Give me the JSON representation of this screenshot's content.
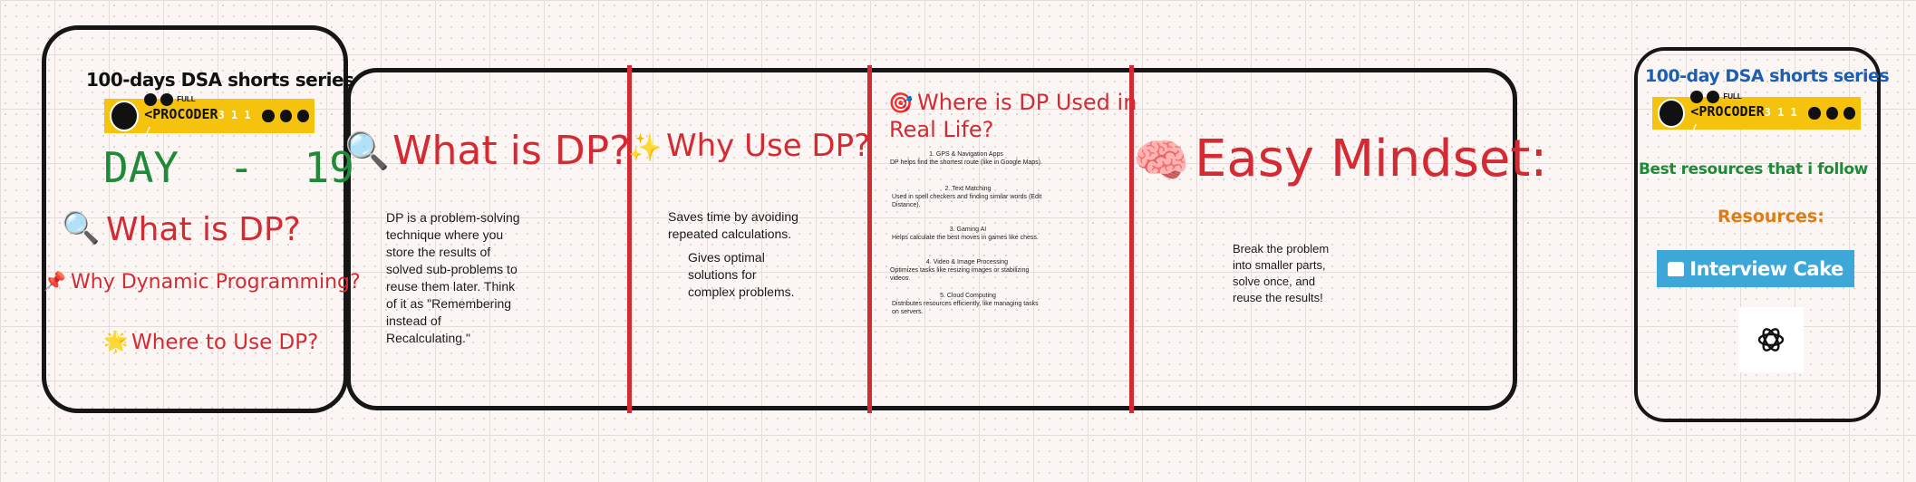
{
  "left_card": {
    "series_title": "100-days DSA shorts series",
    "banner_name": "<PROCODER",
    "banner_suffix": "3 1 1 /",
    "day_label": "DAY  -  19",
    "what_is_dp": "What is DP?",
    "why_dp": "Why Dynamic Programming?",
    "where_dp": "Where to Use DP?",
    "icons": [
      "magnifier-icon",
      "pushpin-icon",
      "sparkle-icon"
    ]
  },
  "what_is_dp": {
    "heading": "What is DP?",
    "body": [
      "DP is a problem-solving",
      "technique where you",
      "store the results of",
      "solved sub-problems to",
      "reuse them later. Think",
      "of it as \"Remembering",
      "instead of",
      "Recalculating.\""
    ]
  },
  "why_use_dp": {
    "heading": "Why Use DP?",
    "line1": [
      "Saves time by avoiding",
      "repeated calculations."
    ],
    "line2": [
      "Gives optimal",
      "solutions for",
      "complex problems."
    ]
  },
  "real_life": {
    "heading_line1": "Where is DP Used in",
    "heading_line2": "Real Life?",
    "items": [
      {
        "title": "1. GPS & Navigation Apps",
        "desc": "DP helps find the shortest route (like in Google Maps)."
      },
      {
        "title": "2. Text Matching",
        "desc": "Used in spell checkers and finding similar words (Edit Distance)."
      },
      {
        "title": "3. Gaming AI",
        "desc": "Helps calculate the best moves in games like chess."
      },
      {
        "title": "4. Video & Image Processing",
        "desc": "Optimizes tasks like resizing images or stabilizing videos."
      },
      {
        "title": "5. Cloud Computing",
        "desc": "Distributes resources efficiently, like managing tasks on servers."
      }
    ]
  },
  "mindset": {
    "heading": "Easy Mindset:",
    "body": [
      "Break the problem",
      "into smaller parts,",
      "solve once, and",
      "reuse the results!"
    ]
  },
  "right_card": {
    "series_title": "100-day DSA shorts series",
    "banner_name": "<PROCODER",
    "banner_suffix": "3 1 1 /",
    "best_resources": "Best resources that i follow",
    "resources_label": "Resources:",
    "interview_cake": "Interview Cake"
  },
  "colors": {
    "accent_red": "#d42a33",
    "green": "#1f8a3a",
    "blue": "#1a5fb4",
    "orange": "#e07b12",
    "banner_yellow": "#f5c20e",
    "cake_blue": "#3da7d8"
  }
}
